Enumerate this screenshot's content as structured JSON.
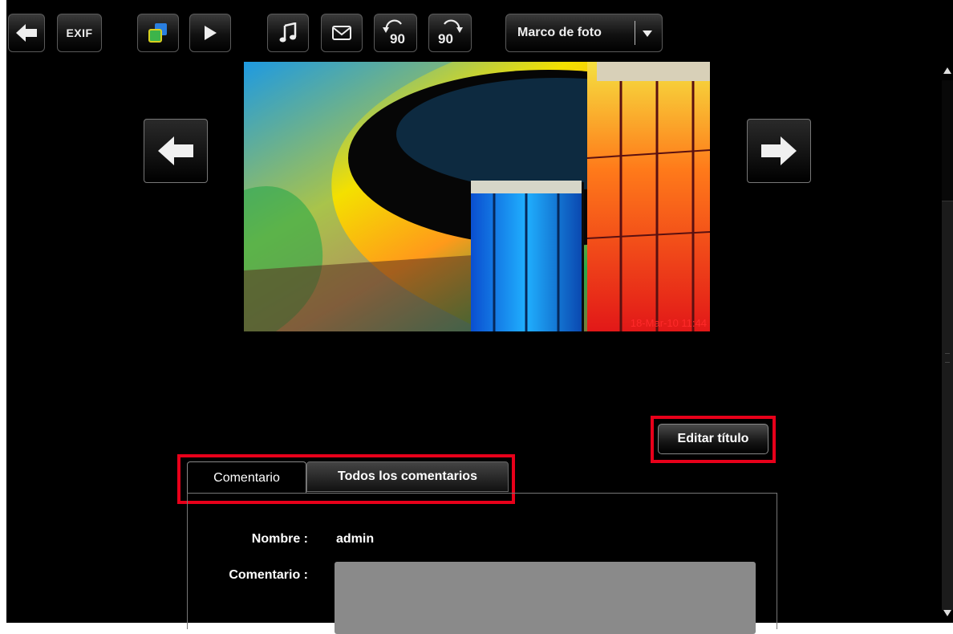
{
  "toolbar": {
    "back": "back-arrow-icon",
    "exif_label": "EXIF",
    "frame_select_label": "Marco de foto",
    "rotate_left_label": "90",
    "rotate_right_label": "90"
  },
  "photo": {
    "timestamp": "18-Mar-10 11:44"
  },
  "edit_title_label": "Editar título",
  "tabs": [
    {
      "label": "Comentario",
      "active": true
    },
    {
      "label": "Todos los comentarios",
      "active": false
    }
  ],
  "form": {
    "name_label": "Nombre :",
    "name_value": "admin",
    "comment_label": "Comentario :"
  },
  "colors": {
    "highlight": "#e8001a",
    "background": "#000000"
  }
}
